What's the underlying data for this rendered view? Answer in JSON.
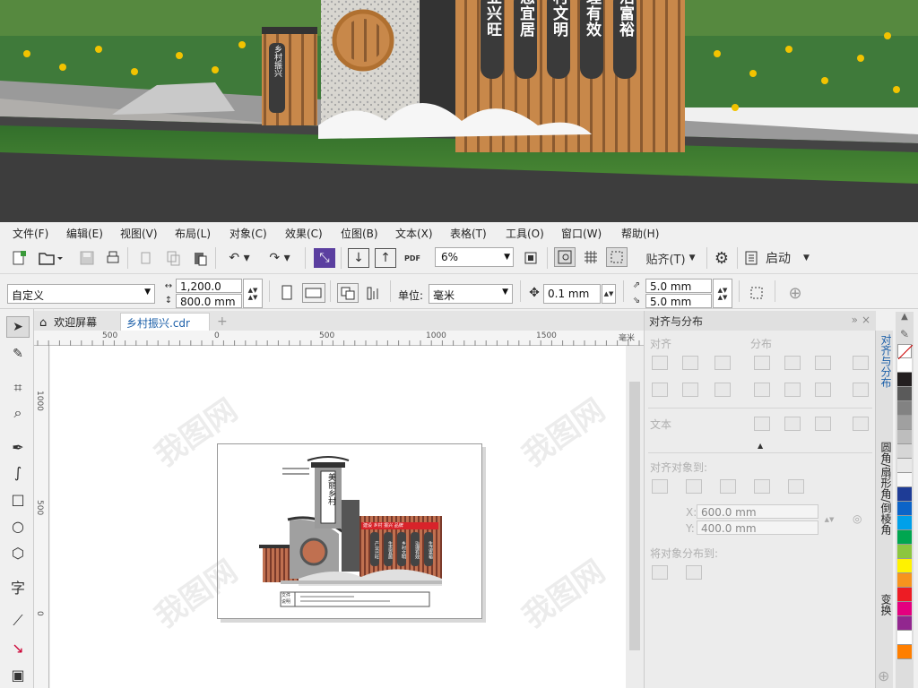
{
  "menu": [
    "文件(F)",
    "编辑(E)",
    "视图(V)",
    "布局(L)",
    "对象(C)",
    "效果(C)",
    "位图(B)",
    "文本(X)",
    "表格(T)",
    "工具(O)",
    "窗口(W)",
    "帮助(H)"
  ],
  "toolbar": {
    "zoom": "6%",
    "snap_label": "贴齐(T)",
    "launch_label": "启动",
    "pdf_label": "PDF"
  },
  "property_bar": {
    "page_preset": "自定义",
    "width": "1,200.0 mm",
    "height": "800.0 mm",
    "units_label": "单位:",
    "units_value": "毫米",
    "nudge": "0.1 mm",
    "dup_x": "5.0 mm",
    "dup_y": "5.0 mm"
  },
  "tabs": [
    "欢迎屏幕",
    "乡村振兴.cdr"
  ],
  "ruler": {
    "h_ticks": [
      "500",
      "0",
      "500",
      "1000",
      "1500"
    ],
    "h_unit": "毫米",
    "v_ticks": [
      "1000",
      "500",
      "0"
    ]
  },
  "panel": {
    "title": "对齐与分布",
    "align": "对齐",
    "distribute": "分布",
    "text": "文本",
    "align_to": "对齐对象到:",
    "x_label": "X:",
    "x_value": "600.0 mm",
    "y_label": "Y:",
    "y_value": "400.0 mm",
    "distribute_to": "将对象分布到:"
  },
  "side_tabs": [
    "对齐与分布",
    "圆角/扇形角/倒棱角",
    "变换"
  ],
  "scene": {
    "sign_plaques": [
      "产业兴旺",
      "生态宜居",
      "乡村文明",
      "治理有效",
      "生活富裕"
    ],
    "side_sign": "乡村振兴"
  },
  "artboard": {
    "title_plaque": "美丽乡村",
    "banner": "建设 乡村 振兴 品牌",
    "plaques": [
      "产业兴旺",
      "生态宜居",
      "乡村文明",
      "治理有效",
      "生活富裕"
    ],
    "note_label_1": "文件",
    "note_label_2": "说明"
  },
  "watermark": "我图网",
  "palette_colors": [
    "#ffffff",
    "#231f20",
    "#5a5a5a",
    "#828282",
    "#a0a0a0",
    "#bdbdbd",
    "#d6d6d6",
    "#e8e8e8",
    "#f7f7f7",
    "#1e3c96",
    "#0c64c8",
    "#00a0e9",
    "#00a650",
    "#8cc63f",
    "#fff200",
    "#f7941d",
    "#ed1c24",
    "#e4007f",
    "#92278f",
    "#ffffff",
    "#ff7f00"
  ],
  "colors": {
    "sign_red": "#d8232a",
    "wood": "#c8884a",
    "accent_blue": "#1e78d4"
  }
}
